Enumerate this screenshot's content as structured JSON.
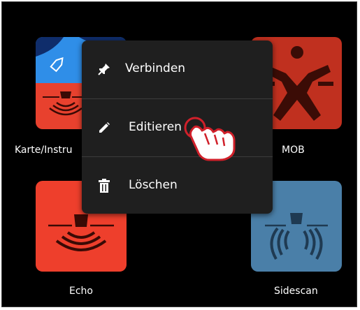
{
  "apps": {
    "karte": {
      "label": "Karte/Instru"
    },
    "mob": {
      "label": "MOB"
    },
    "echo": {
      "label": "Echo"
    },
    "sidescan": {
      "label": "Sidescan"
    }
  },
  "context_menu": {
    "items": [
      {
        "label": "Verbinden",
        "icon": "pin-icon"
      },
      {
        "label": "Editieren",
        "icon": "pencil-icon"
      },
      {
        "label": "Löschen",
        "icon": "trash-icon"
      }
    ]
  },
  "colors": {
    "background": "#000000",
    "menu_bg": "#1f1f1f",
    "chart_blue": "#2f8ee8",
    "instrument_red": "#e8412e",
    "mob_red": "#c0301f",
    "echo_red": "#ee3f2c",
    "sidescan_blue": "#4a7fa8"
  }
}
